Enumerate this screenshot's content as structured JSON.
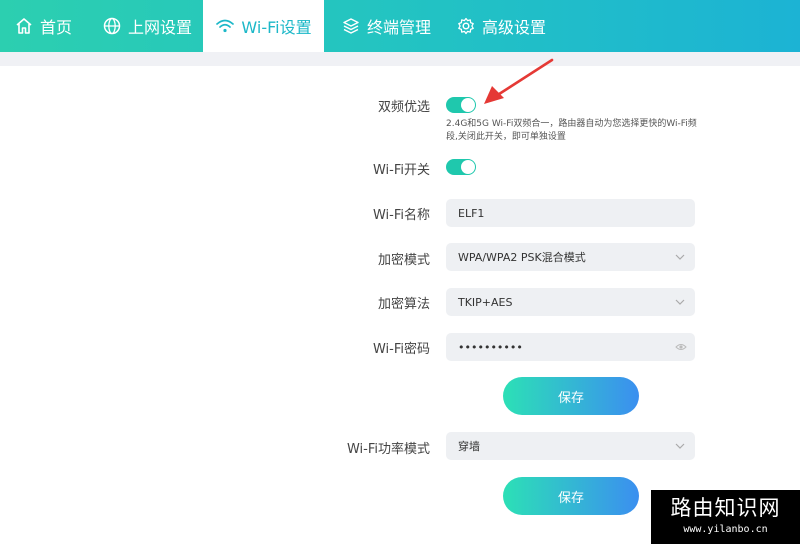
{
  "nav": {
    "home": "首页",
    "internet": "上网设置",
    "wifi": "Wi-Fi设置",
    "terminal": "终端管理",
    "advanced": "高级设置"
  },
  "dual_band": {
    "label": "双频优选",
    "enabled": true,
    "hint": "2.4G和5G Wi-Fi双频合一，路由器自动为您选择更快的Wi-Fi频段,关闭此开关，即可单独设置"
  },
  "wifi_switch": {
    "label": "Wi-Fi开关",
    "enabled": true
  },
  "wifi_name": {
    "label": "Wi-Fi名称",
    "value": "ELF1"
  },
  "encryption_mode": {
    "label": "加密模式",
    "value": "WPA/WPA2 PSK混合模式"
  },
  "encryption_algo": {
    "label": "加密算法",
    "value": "TKIP+AES"
  },
  "wifi_password": {
    "label": "Wi-Fi密码",
    "value": "••••••••••"
  },
  "save1": "保存",
  "power_mode": {
    "label": "Wi-Fi功率模式",
    "value": "穿墙"
  },
  "save2": "保存",
  "watermark": {
    "title": "路由知识网",
    "url": "www.yilanbo.cn"
  },
  "colors": {
    "accent": "#1fc8ad",
    "nav_start": "#2ccfb0",
    "nav_end": "#1cb3d4",
    "arrow": "#e53935"
  }
}
